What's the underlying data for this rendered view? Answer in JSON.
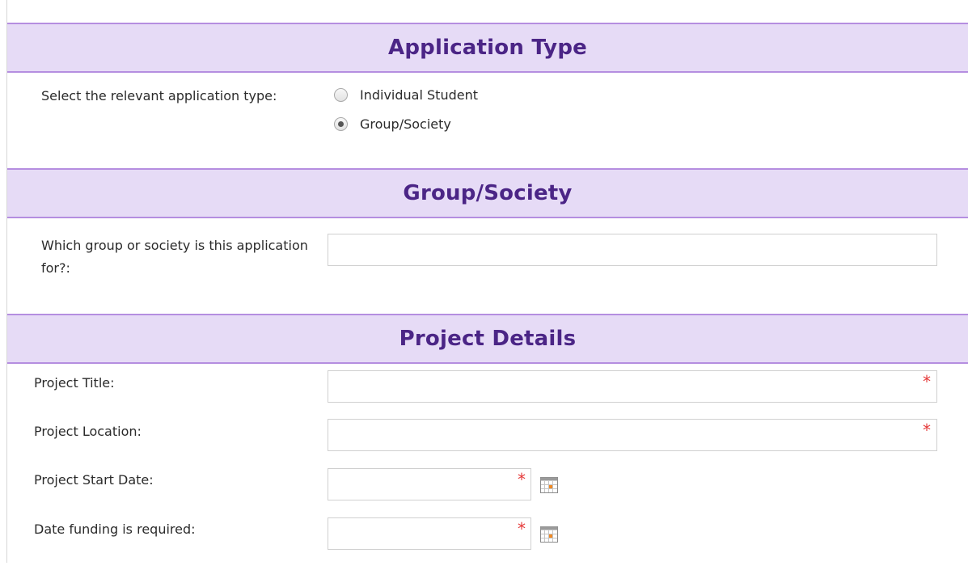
{
  "sections": {
    "application_type": {
      "title": "Application Type",
      "question": "Select the relevant application type:",
      "options": [
        {
          "label": "Individual Student",
          "selected": false
        },
        {
          "label": "Group/Society",
          "selected": true
        }
      ]
    },
    "group_society": {
      "title": "Group/Society",
      "question": "Which group or society is this application for?:",
      "value": ""
    },
    "project_details": {
      "title": "Project Details",
      "fields": [
        {
          "label": "Project Title:",
          "value": "",
          "required_marker": "*"
        },
        {
          "label": "Project Location:",
          "value": "",
          "required_marker": "*"
        },
        {
          "label": "Project Start Date:",
          "value": "",
          "required_marker": "*",
          "icon": "calendar-icon"
        },
        {
          "label": "Date funding is required:",
          "value": "",
          "required_marker": "*",
          "icon": "calendar-icon"
        }
      ]
    }
  },
  "colors": {
    "header_bg": "#e6dbf6",
    "header_border": "#b58ee0",
    "header_text": "#4b2586",
    "required": "#e53939"
  }
}
